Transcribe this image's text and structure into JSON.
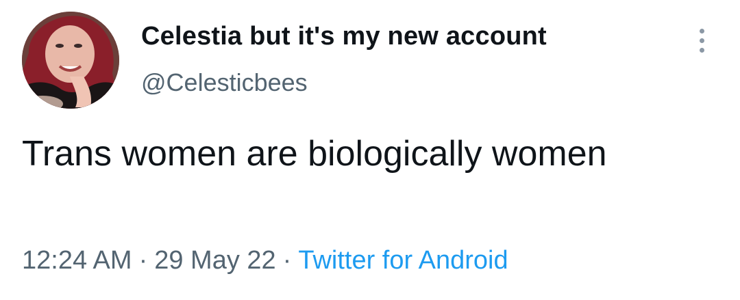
{
  "tweet": {
    "author": {
      "display_name": "Celestia but it's my new account",
      "handle": "@Celesticbees"
    },
    "text": "Trans women are biologically women",
    "time": "12:24 AM",
    "separator": "·",
    "date": "29 May 22",
    "source": "Twitter for Android"
  },
  "icons": {
    "more": "more-vertical-icon"
  },
  "colors": {
    "text_primary": "#0f1419",
    "text_secondary": "#536471",
    "link": "#1d9bf0",
    "more_dots": "#8b98a5"
  }
}
